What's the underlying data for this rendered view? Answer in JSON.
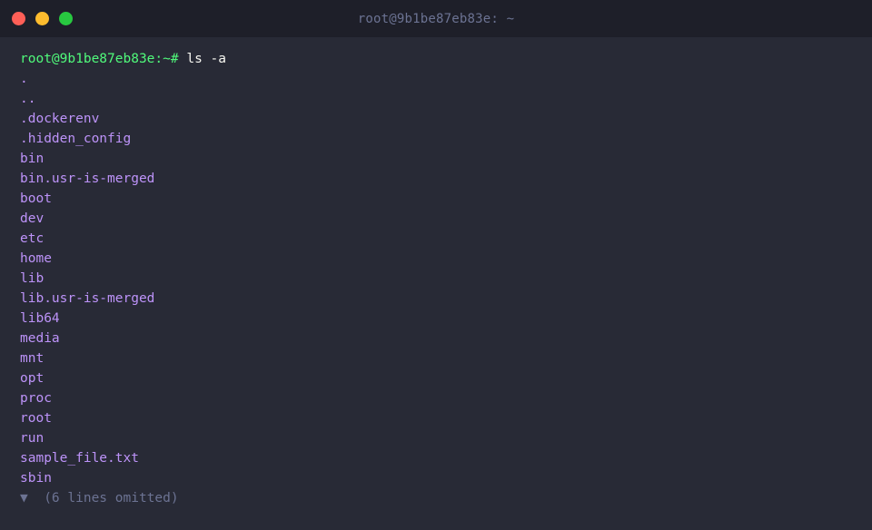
{
  "window": {
    "title": "root@9b1be87eb83e: ~",
    "controls": {
      "close_color": "#ff5f57",
      "minimize_color": "#febc2e",
      "maximize_color": "#28c840"
    }
  },
  "terminal": {
    "prompt": "root@9b1be87eb83e:~#",
    "command": "ls -a",
    "entries": [
      ".",
      "..",
      ".dockerenv",
      ".hidden_config",
      "bin",
      "bin.usr-is-merged",
      "boot",
      "dev",
      "etc",
      "home",
      "lib",
      "lib.usr-is-merged",
      "lib64",
      "media",
      "mnt",
      "opt",
      "proc",
      "root",
      "run",
      "sample_file.txt",
      "sbin"
    ],
    "omitted_label": "(6 lines omitted)",
    "omitted_caret": "▼"
  },
  "colors": {
    "background": "#282a36",
    "titlebar": "#1e1f29",
    "prompt": "#50fa7b",
    "entry": "#bd93f9",
    "muted": "#6c7393"
  }
}
